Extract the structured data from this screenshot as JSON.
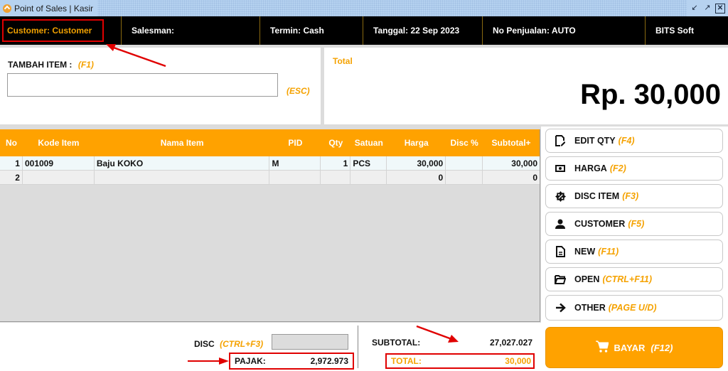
{
  "window": {
    "title": "Point of Sales | Kasir",
    "controls": [
      "minimize-icon",
      "restore-icon",
      "close-icon"
    ]
  },
  "infobar": {
    "customer": "Customer:  Customer",
    "salesman": "Salesman:",
    "termin": "Termin:  Cash",
    "tanggal": "Tanggal:  22 Sep 2023",
    "no_penjualan": "No Penjualan:  AUTO",
    "brand": "BITS Soft"
  },
  "tambah_item": {
    "label": "TAMBAH ITEM :",
    "key": "(F1)",
    "value": "",
    "esc_key": "(ESC)"
  },
  "total_panel": {
    "label": "Total",
    "amount": "Rp. 30,000"
  },
  "grid": {
    "columns": [
      "No",
      "Kode Item",
      "Nama Item",
      "PID",
      "Qty",
      "Satuan",
      "Harga",
      "Disc %",
      "Subtotal+"
    ],
    "rows": [
      {
        "no": "1",
        "kode": "001009",
        "nama": "Baju KOKO",
        "pid": "M",
        "qty": "1",
        "satuan": "PCS",
        "harga": "30,000",
        "disc": "",
        "subtotal": "30,000"
      },
      {
        "no": "2",
        "kode": "",
        "nama": "",
        "pid": "",
        "qty": "",
        "satuan": "",
        "harga": "0",
        "disc": "",
        "subtotal": "0"
      }
    ]
  },
  "actions": [
    {
      "label": "EDIT QTY",
      "key": "(F4)",
      "icon": "edit-document-icon"
    },
    {
      "label": "HARGA",
      "key": "(F2)",
      "icon": "money-icon"
    },
    {
      "label": "DISC ITEM",
      "key": "(F3)",
      "icon": "discount-badge-icon"
    },
    {
      "label": "CUSTOMER",
      "key": "(F5)",
      "icon": "person-icon"
    },
    {
      "label": "NEW",
      "key": "(F11)",
      "icon": "new-document-icon"
    },
    {
      "label": "OPEN",
      "key": "(CTRL+F11)",
      "icon": "folder-open-icon"
    },
    {
      "label": "OTHER",
      "key": "(PAGE U/D)",
      "icon": "arrow-right-icon"
    }
  ],
  "bayar": {
    "label": "BAYAR",
    "key": "(F12)",
    "icon": "cart-icon"
  },
  "summary": {
    "disc_label": "DISC",
    "disc_key": "(CTRL+F3)",
    "disc_value": "",
    "pajak_label": "PAJAK:",
    "pajak_value": "2,972.973",
    "subtotal_label": "SUBTOTAL:",
    "subtotal_value": "27,027.027",
    "total_label": "TOTAL:",
    "total_value": "30,000"
  },
  "colors": {
    "accent": "#ffa200",
    "header_bg": "#000000",
    "annotation": "#e00000"
  }
}
